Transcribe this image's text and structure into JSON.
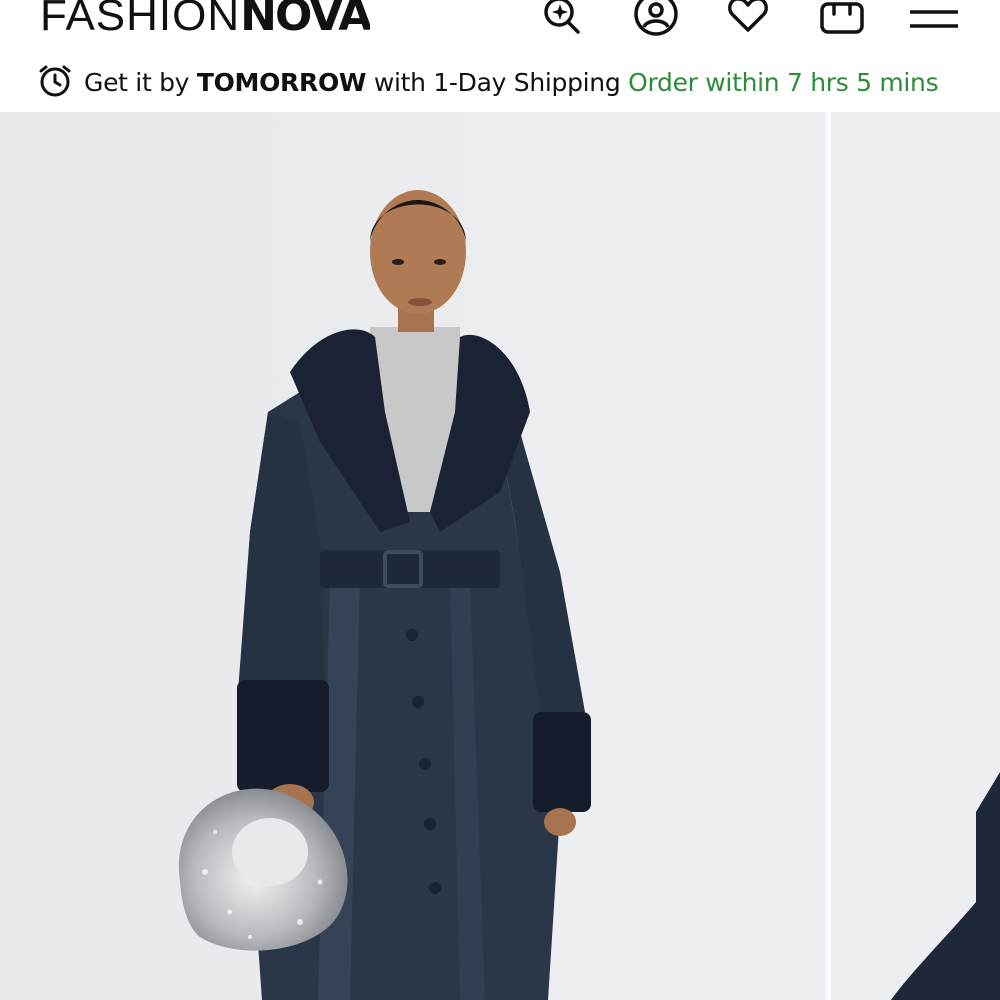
{
  "header": {
    "logo_light": "FASHION",
    "logo_bold": "NOVA",
    "icons": [
      "search-sparkle-icon",
      "account-icon",
      "heart-icon",
      "bag-icon",
      "menu-icon"
    ]
  },
  "shipping": {
    "prefix": "Get it by ",
    "highlight": "TOMORROW",
    "middle": " with 1-Day Shipping ",
    "countdown": "Order within 7 hrs 5 mins",
    "accent_color": "#2e8b3a",
    "icon": "clock-icon"
  },
  "gallery": {
    "images": [
      "product-photo-main",
      "product-photo-next"
    ]
  }
}
